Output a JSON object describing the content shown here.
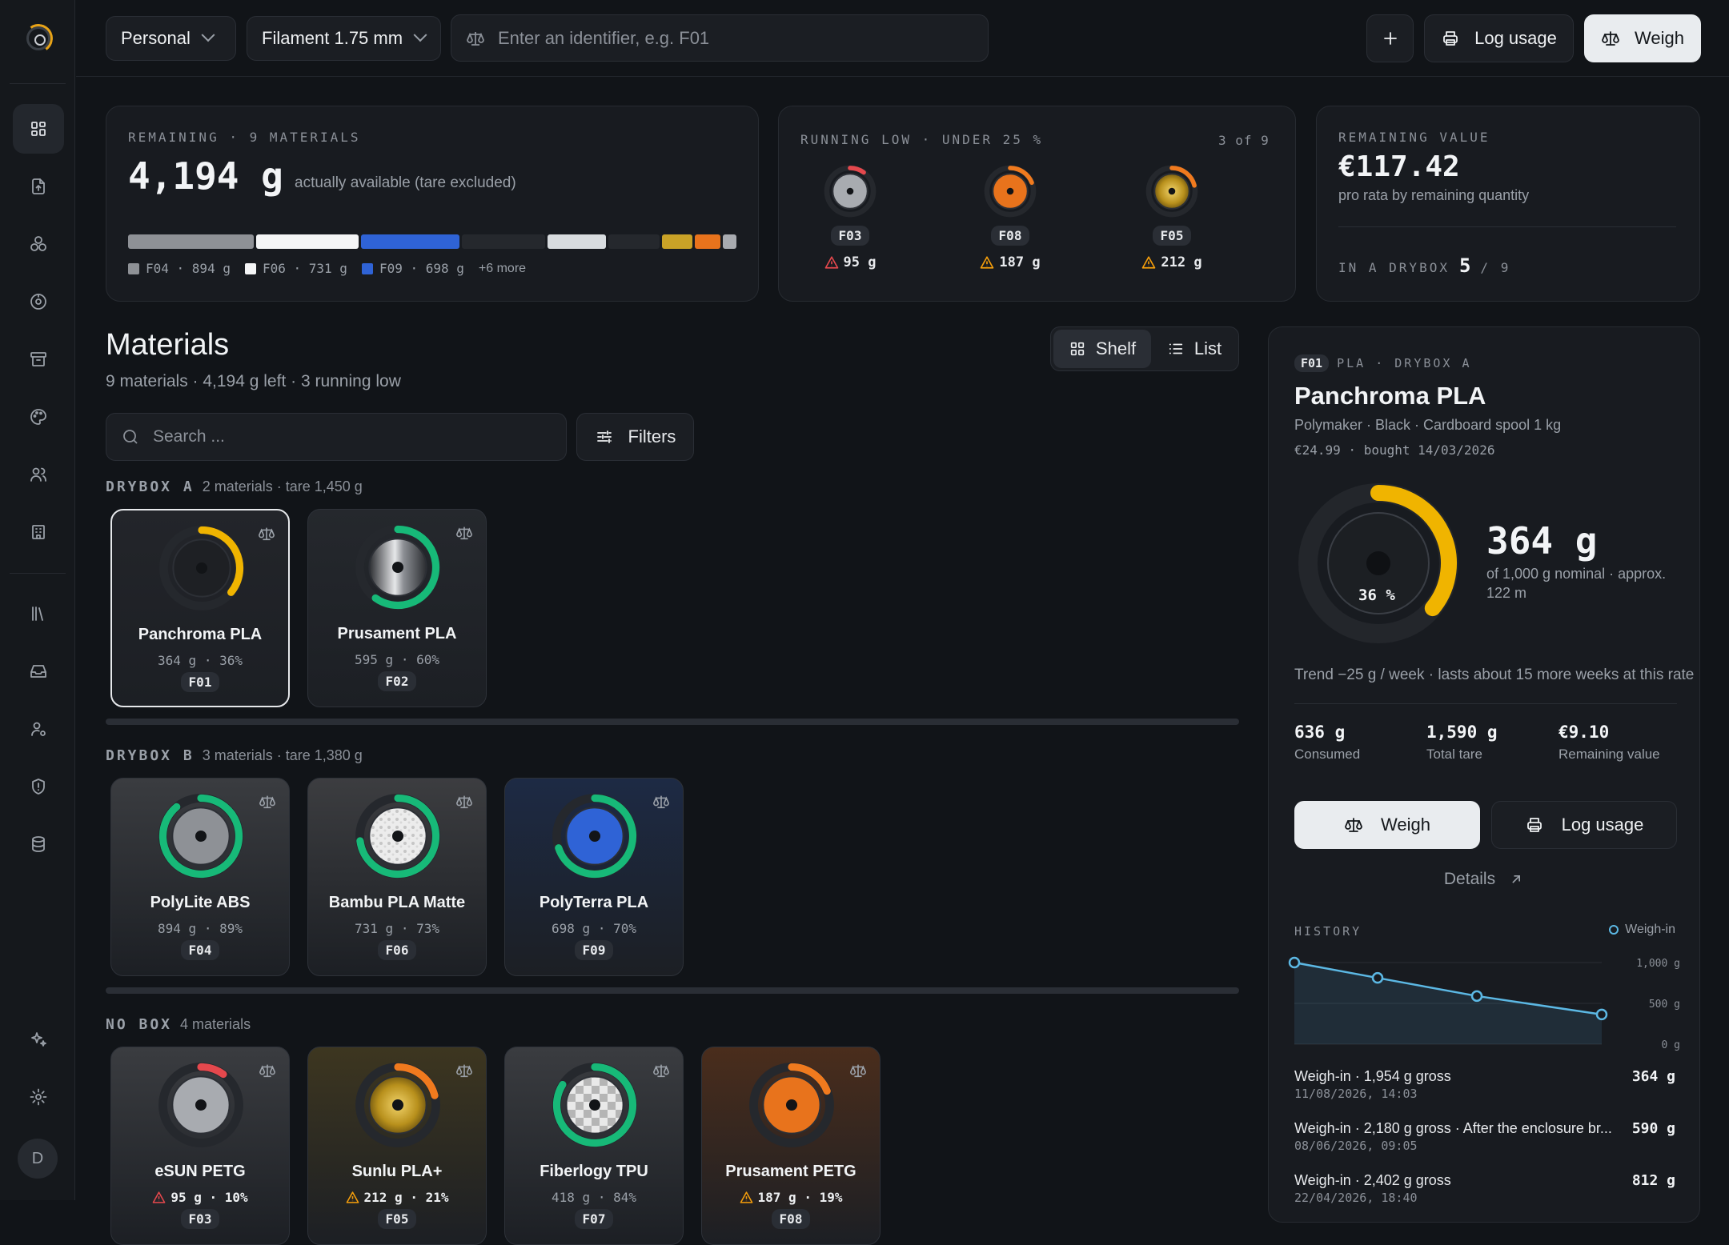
{
  "topbar": {
    "workspace": "Personal",
    "material_type": "Filament 1.75 mm",
    "identifier_placeholder": "Enter an identifier, e.g. F01",
    "log_usage_label": "Log usage",
    "weigh_label": "Weigh"
  },
  "summary": {
    "remaining": {
      "eyebrow": "REMAINING · 9 MATERIALS",
      "value": "4,194 g",
      "note": "actually available (tare excluded)",
      "legend": [
        {
          "label": "F04 · 894 g",
          "color": "#8e9196"
        },
        {
          "label": "F06 · 731 g",
          "color": "#f4f5f6"
        },
        {
          "label": "F09 · 698 g",
          "color": "#2f63d6"
        }
      ],
      "more": "+6 more",
      "segments": [
        {
          "id": "F04",
          "grams": 894,
          "color": "#8e9196"
        },
        {
          "id": "F06",
          "grams": 731,
          "color": "#f4f5f6"
        },
        {
          "id": "F09",
          "grams": 698,
          "color": "#2f63d6"
        },
        {
          "id": "F02",
          "grams": 595,
          "color": "#25282d"
        },
        {
          "id": "F07",
          "grams": 418,
          "color": "#d8dcdf"
        },
        {
          "id": "F01",
          "grams": 364,
          "color": "#25282d"
        },
        {
          "id": "F05",
          "grams": 212,
          "color": "#c9a227"
        },
        {
          "id": "F08",
          "grams": 187,
          "color": "#e8731c"
        },
        {
          "id": "F03",
          "grams": 95,
          "color": "#a8abb0"
        }
      ]
    },
    "low": {
      "eyebrow": "RUNNING LOW · UNDER 25 %",
      "count": "3 of 9",
      "items": [
        {
          "id": "F03",
          "grams": "95 g",
          "fraction": 0.1,
          "color": "#a8abb0",
          "arc": "#e5484d",
          "warn": "#e5484d"
        },
        {
          "id": "F08",
          "grams": "187 g",
          "fraction": 0.19,
          "color": "#e8731c",
          "arc": "#f07a1e",
          "warn": "#f59e0b"
        },
        {
          "id": "F05",
          "grams": "212 g",
          "fraction": 0.21,
          "color": "#c9a227",
          "arc": "#f07a1e",
          "warn": "#f59e0b"
        }
      ]
    },
    "value": {
      "eyebrow": "REMAINING VALUE",
      "amount": "€117.42",
      "note": "pro rata by remaining quantity",
      "drybox_label": "IN A DRYBOX",
      "drybox_count": "5",
      "drybox_total": "/ 9"
    }
  },
  "materials": {
    "title": "Materials",
    "subtitle": "9 materials · 4,194 g left · 3 running low",
    "view_shelf": "Shelf",
    "view_list": "List",
    "search_placeholder": "Search ...",
    "filters_label": "Filters",
    "groups": [
      {
        "name": "DRYBOX A",
        "info": "2 materials · tare 1,450 g",
        "items": [
          {
            "name": "Panchroma PLA",
            "stat": "364 g · 36%",
            "id": "F01",
            "fraction": 0.36,
            "arc": "#f0b400",
            "fill": "#1e2024",
            "bg": "#23252a",
            "low": false,
            "selected": true
          },
          {
            "name": "Prusament PLA",
            "stat": "595 g · 60%",
            "id": "F02",
            "fraction": 0.6,
            "arc": "#17b978",
            "fill": "metal",
            "bg": "#25282d",
            "low": false
          }
        ]
      },
      {
        "name": "DRYBOX B",
        "info": "3 materials · tare 1,380 g",
        "items": [
          {
            "name": "PolyLite ABS",
            "stat": "894 g · 89%",
            "id": "F04",
            "fraction": 0.89,
            "arc": "#17b978",
            "fill": "#8e9196",
            "bg": "#3a3c40",
            "low": false
          },
          {
            "name": "Bambu PLA Matte",
            "stat": "731 g · 73%",
            "id": "F06",
            "fraction": 0.73,
            "arc": "#17b978",
            "fill": "marble",
            "bg": "#3c3d40",
            "low": false
          },
          {
            "name": "PolyTerra PLA",
            "stat": "698 g · 70%",
            "id": "F09",
            "fraction": 0.7,
            "arc": "#17b978",
            "fill": "#2f63d6",
            "bg": "#1d2a44",
            "low": false
          }
        ]
      },
      {
        "name": "NO BOX",
        "info": "4 materials",
        "items": [
          {
            "name": "eSUN PETG",
            "stat": "95 g · 10%",
            "id": "F03",
            "fraction": 0.1,
            "arc": "#e5484d",
            "fill": "#a8abb0",
            "bg": "#3a3c40",
            "low": true,
            "warn": "#e5484d"
          },
          {
            "name": "Sunlu PLA+",
            "stat": "212 g · 21%",
            "id": "F05",
            "fraction": 0.21,
            "arc": "#f07a1e",
            "fill": "gold",
            "bg": "#3d3620",
            "low": true,
            "warn": "#f59e0b"
          },
          {
            "name": "Fiberlogy TPU",
            "stat": "418 g · 84%",
            "id": "F07",
            "fraction": 0.84,
            "arc": "#17b978",
            "fill": "checker",
            "bg": "#3a3c40",
            "low": false
          },
          {
            "name": "Prusament PETG",
            "stat": "187 g · 19%",
            "id": "F08",
            "fraction": 0.19,
            "arc": "#f07a1e",
            "fill": "#e8731c",
            "bg": "#4a2d1c",
            "low": true,
            "warn": "#f59e0b"
          }
        ]
      }
    ]
  },
  "detail": {
    "id": "F01",
    "meta": "PLA · DRYBOX A",
    "name": "Panchroma PLA",
    "brand_line": "Polymaker · Black · Cardboard spool 1 kg",
    "price_line": "€24.99 · bought 14/03/2026",
    "percent": "36 %",
    "fraction": 0.36,
    "grams": "364 g",
    "nominal": "of 1,000 g nominal · approx. 122 m",
    "trend": "Trend −25 g / week · lasts about 15 more weeks at this rate",
    "stats": [
      {
        "value": "636 g",
        "label": "Consumed"
      },
      {
        "value": "1,590 g",
        "label": "Total tare"
      },
      {
        "value": "€9.10",
        "label": "Remaining value"
      }
    ],
    "weigh_label": "Weigh",
    "log_label": "Log usage",
    "details_label": "Details",
    "history_title": "HISTORY",
    "history_legend": "Weigh-in",
    "history_ticks": [
      "1,000 g",
      "500 g",
      "0 g"
    ],
    "history": [
      {
        "title": "Weigh-in · 1,954 g gross",
        "date": "11/08/2026, 14:03",
        "value": "364 g"
      },
      {
        "title": "Weigh-in · 2,180 g gross · After the enclosure br...",
        "date": "08/06/2026, 09:05",
        "value": "590 g"
      },
      {
        "title": "Weigh-in · 2,402 g gross",
        "date": "22/04/2026, 18:40",
        "value": "812 g"
      }
    ]
  },
  "chart_data": {
    "type": "area",
    "x": [
      "14/03/2026",
      "22/04/2026",
      "08/06/2026",
      "11/08/2026"
    ],
    "series": [
      {
        "name": "Weigh-in",
        "values": [
          1000,
          812,
          590,
          364
        ]
      }
    ],
    "ylim": [
      0,
      1000
    ],
    "ylabel": "",
    "grid": true,
    "legend": "top-right"
  },
  "sidebar": {
    "avatar": "D"
  }
}
